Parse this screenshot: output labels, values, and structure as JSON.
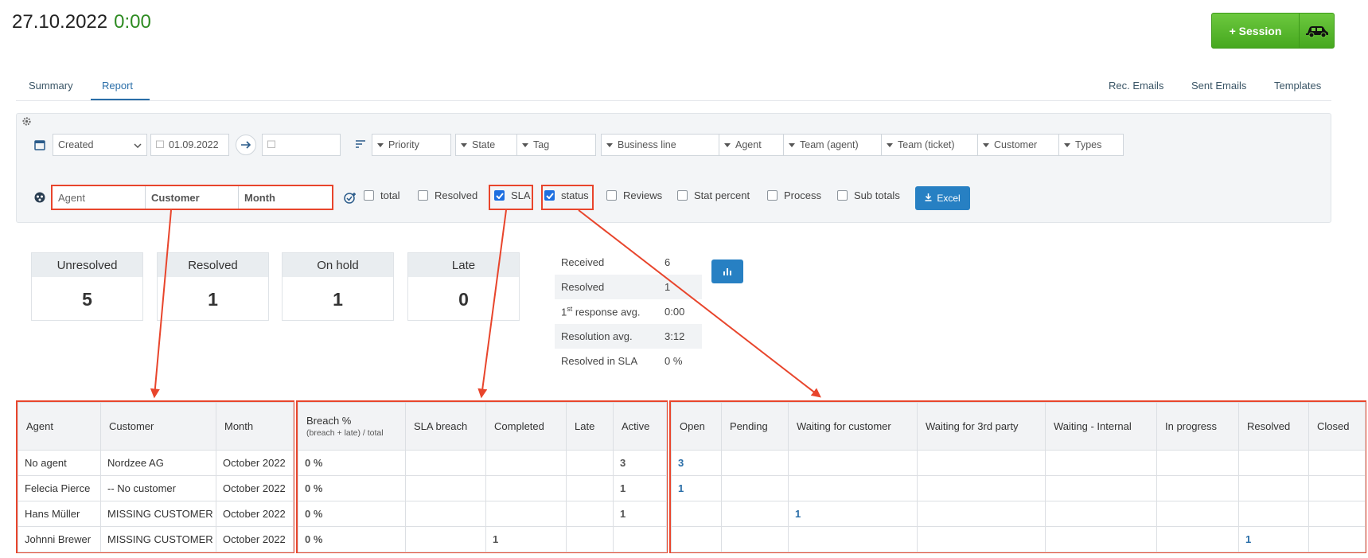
{
  "header": {
    "date": "27.10.2022",
    "time": "0:00",
    "session_label": "+ Session"
  },
  "tabs": [
    {
      "label": "Summary"
    },
    {
      "label": "Report"
    }
  ],
  "right_tabs": [
    {
      "label": "Rec. Emails"
    },
    {
      "label": "Sent Emails"
    },
    {
      "label": "Templates"
    }
  ],
  "filters": {
    "date_type": "Created",
    "date_from": "01.09.2022",
    "date_to": "",
    "priority": "Priority",
    "state": "State",
    "tag": "Tag",
    "business_line": "Business line",
    "agent": "Agent",
    "team_agent": "Team (agent)",
    "team_ticket": "Team (ticket)",
    "customer": "Customer",
    "types": "Types"
  },
  "grouping": {
    "group1": "Agent",
    "group2": "Customer",
    "group3": "Month"
  },
  "options": [
    {
      "label": "total",
      "checked": false
    },
    {
      "label": "Resolved",
      "checked": false
    },
    {
      "label": "SLA",
      "checked": true
    },
    {
      "label": "status",
      "checked": true
    },
    {
      "label": "Reviews",
      "checked": false
    },
    {
      "label": "Stat percent",
      "checked": false
    },
    {
      "label": "Process",
      "checked": false
    },
    {
      "label": "Sub totals",
      "checked": false
    }
  ],
  "excel_label": "Excel",
  "stats": [
    {
      "label": "Unresolved",
      "value": "5"
    },
    {
      "label": "Resolved",
      "value": "1"
    },
    {
      "label": "On hold",
      "value": "1"
    },
    {
      "label": "Late",
      "value": "0"
    }
  ],
  "summary": {
    "received_label": "Received",
    "received_value": "6",
    "resolved_label": "Resolved",
    "resolved_value": "1",
    "first_resp_label_pre": "1",
    "first_resp_sup": "st",
    "first_resp_label_post": " response avg.",
    "first_resp_value": "0:00",
    "resolution_label": "Resolution avg.",
    "resolution_value": "3:12",
    "in_sla_label": "Resolved in SLA",
    "in_sla_value": "0 %"
  },
  "table1": {
    "headers": [
      "Agent",
      "Customer",
      "Month"
    ],
    "rows": [
      [
        "No agent",
        "Nordzee AG",
        "October 2022"
      ],
      [
        "Felecia Pierce",
        "-- No customer",
        "October 2022"
      ],
      [
        "Hans Müller",
        "MISSING CUSTOMER",
        "October 2022"
      ],
      [
        "Johnni Brewer",
        "MISSING CUSTOMER",
        "October 2022"
      ]
    ]
  },
  "table2": {
    "breach_header": "Breach %",
    "breach_sub": "(breach + late) / total",
    "headers": [
      "SLA breach",
      "Completed",
      "Late",
      "Active"
    ],
    "rows": [
      [
        "0 %",
        "",
        "",
        "",
        "3"
      ],
      [
        "0 %",
        "",
        "",
        "",
        "1"
      ],
      [
        "0 %",
        "",
        "",
        "",
        "1"
      ],
      [
        "0 %",
        "",
        "1",
        "",
        ""
      ]
    ]
  },
  "table3": {
    "headers": [
      "Open",
      "Pending",
      "Waiting for customer",
      "Waiting for 3rd party",
      "Waiting - Internal",
      "In progress",
      "Resolved",
      "Closed"
    ],
    "rows": [
      [
        "3",
        "",
        "",
        "",
        "",
        "",
        "",
        ""
      ],
      [
        "1",
        "",
        "",
        "",
        "",
        "",
        "",
        ""
      ],
      [
        "",
        "",
        "1",
        "",
        "",
        "",
        "",
        ""
      ],
      [
        "",
        "",
        "",
        "",
        "",
        "",
        "1",
        ""
      ]
    ]
  },
  "colors": {
    "accent": "#2a6ea8",
    "annotation": "#e8452c",
    "green": "#46a81f"
  }
}
